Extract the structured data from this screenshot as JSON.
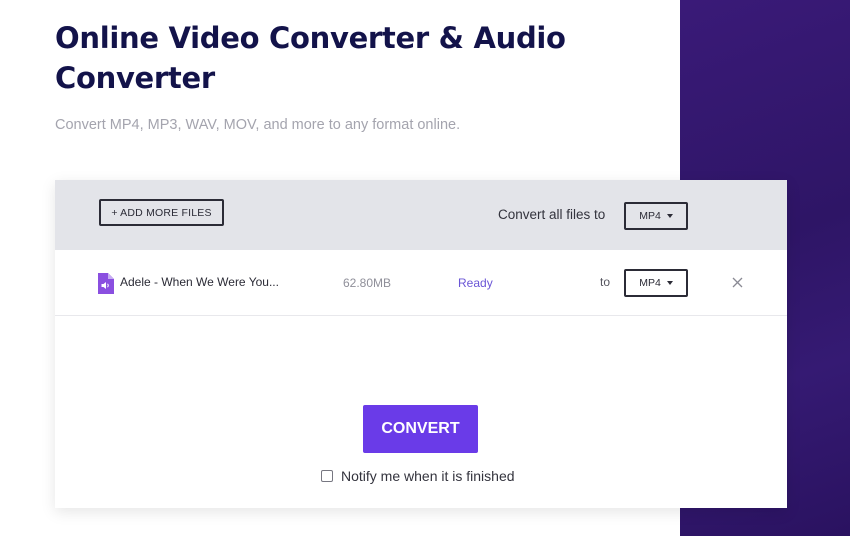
{
  "header": {
    "title": "Online Video Converter & Audio Converter",
    "subtitle": "Convert MP4, MP3, WAV, MOV, and more to any format online."
  },
  "toolbar": {
    "add_files_label": "+ ADD MORE FILES",
    "convert_all_label": "Convert all files to",
    "convert_all_format": "MP4"
  },
  "files": [
    {
      "name": "Adele - When We Were You...",
      "size": "62.80MB",
      "status": "Ready",
      "to_label": "to",
      "format": "MP4",
      "icon": "audio-file-icon"
    }
  ],
  "actions": {
    "convert_label": "CONVERT",
    "notify_label": "Notify me when it is finished",
    "notify_checked": false
  },
  "colors": {
    "accent": "#6a3be8",
    "status": "#6a55d6",
    "title": "#13134a",
    "side_panel": "#2e1566"
  }
}
